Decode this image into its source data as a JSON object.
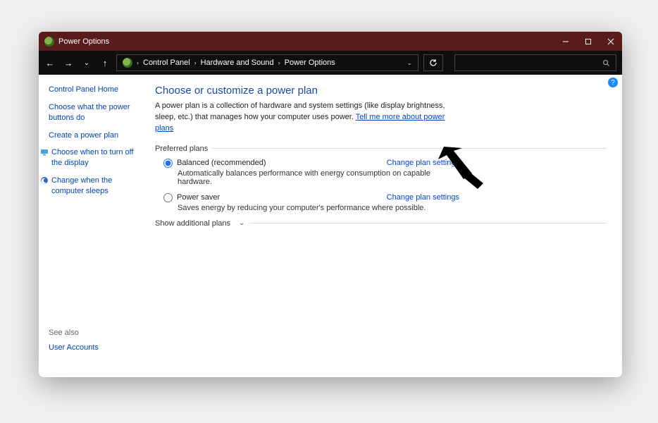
{
  "titlebar": {
    "title": "Power Options"
  },
  "breadcrumb": {
    "items": [
      "Control Panel",
      "Hardware and Sound",
      "Power Options"
    ]
  },
  "sidebar": {
    "home": "Control Panel Home",
    "links": [
      "Choose what the power buttons do",
      "Create a power plan",
      "Choose when to turn off the display",
      "Change when the computer sleeps"
    ],
    "see_also_label": "See also",
    "see_also_link": "User Accounts"
  },
  "main": {
    "title": "Choose or customize a power plan",
    "description": "A power plan is a collection of hardware and system settings (like display brightness, sleep, etc.) that manages how your computer uses power. ",
    "learn_more": "Tell me more about power plans",
    "preferred_label": "Preferred plans",
    "plans": [
      {
        "name": "Balanced (recommended)",
        "sub": "Automatically balances performance with energy consumption on capable hardware.",
        "change": "Change plan settings",
        "selected": true
      },
      {
        "name": "Power saver",
        "sub": "Saves energy by reducing your computer's performance where possible.",
        "change": "Change plan settings",
        "selected": false
      }
    ],
    "show_additional": "Show additional plans"
  }
}
